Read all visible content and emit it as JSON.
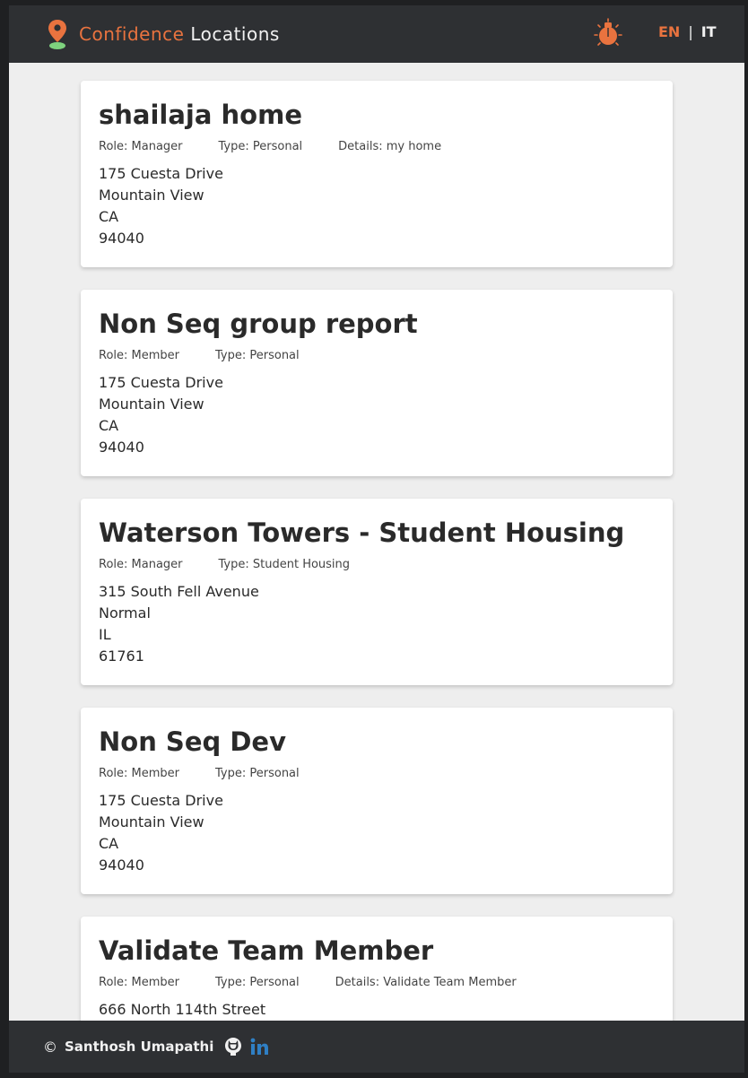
{
  "header": {
    "brand_accent": "Confidence",
    "brand_light": "Locations",
    "theme_toggle_icon": "lightbulb-icon",
    "lang_en": "EN",
    "lang_sep": "|",
    "lang_it": "IT"
  },
  "colors": {
    "accent": "#e9733f",
    "header_bg": "#2e3033",
    "page_bg": "#eeeeee",
    "card_bg": "#ffffff",
    "pin_base": "#7ed27e"
  },
  "locations": [
    {
      "title": "shailaja home",
      "role": "Role: Manager",
      "type": "Type: Personal",
      "details": "Details: my home",
      "street": "175 Cuesta Drive",
      "city": "Mountain View",
      "state": "CA",
      "zip": "94040"
    },
    {
      "title": "Non Seq group report",
      "role": "Role: Member",
      "type": "Type: Personal",
      "details": "",
      "street": "175 Cuesta Drive",
      "city": "Mountain View",
      "state": "CA",
      "zip": "94040"
    },
    {
      "title": "Waterson Towers - Student Housing",
      "role": "Role: Manager",
      "type": "Type: Student Housing",
      "details": "",
      "street": "315 South Fell Avenue",
      "city": "Normal",
      "state": "IL",
      "zip": "61761"
    },
    {
      "title": "Non Seq Dev",
      "role": "Role: Member",
      "type": "Type: Personal",
      "details": "",
      "street": "175 Cuesta Drive",
      "city": "Mountain View",
      "state": "CA",
      "zip": "94040"
    },
    {
      "title": "Validate Team Member",
      "role": "Role: Member",
      "type": "Type: Personal",
      "details": "Details: Validate Team Member",
      "street": "666 North 114th Street",
      "city": "",
      "state": "",
      "zip": ""
    }
  ],
  "footer": {
    "copyright_symbol": "©",
    "author": "Santhosh Umapathi",
    "github_icon": "github-icon",
    "linkedin_icon": "linkedin-icon"
  }
}
